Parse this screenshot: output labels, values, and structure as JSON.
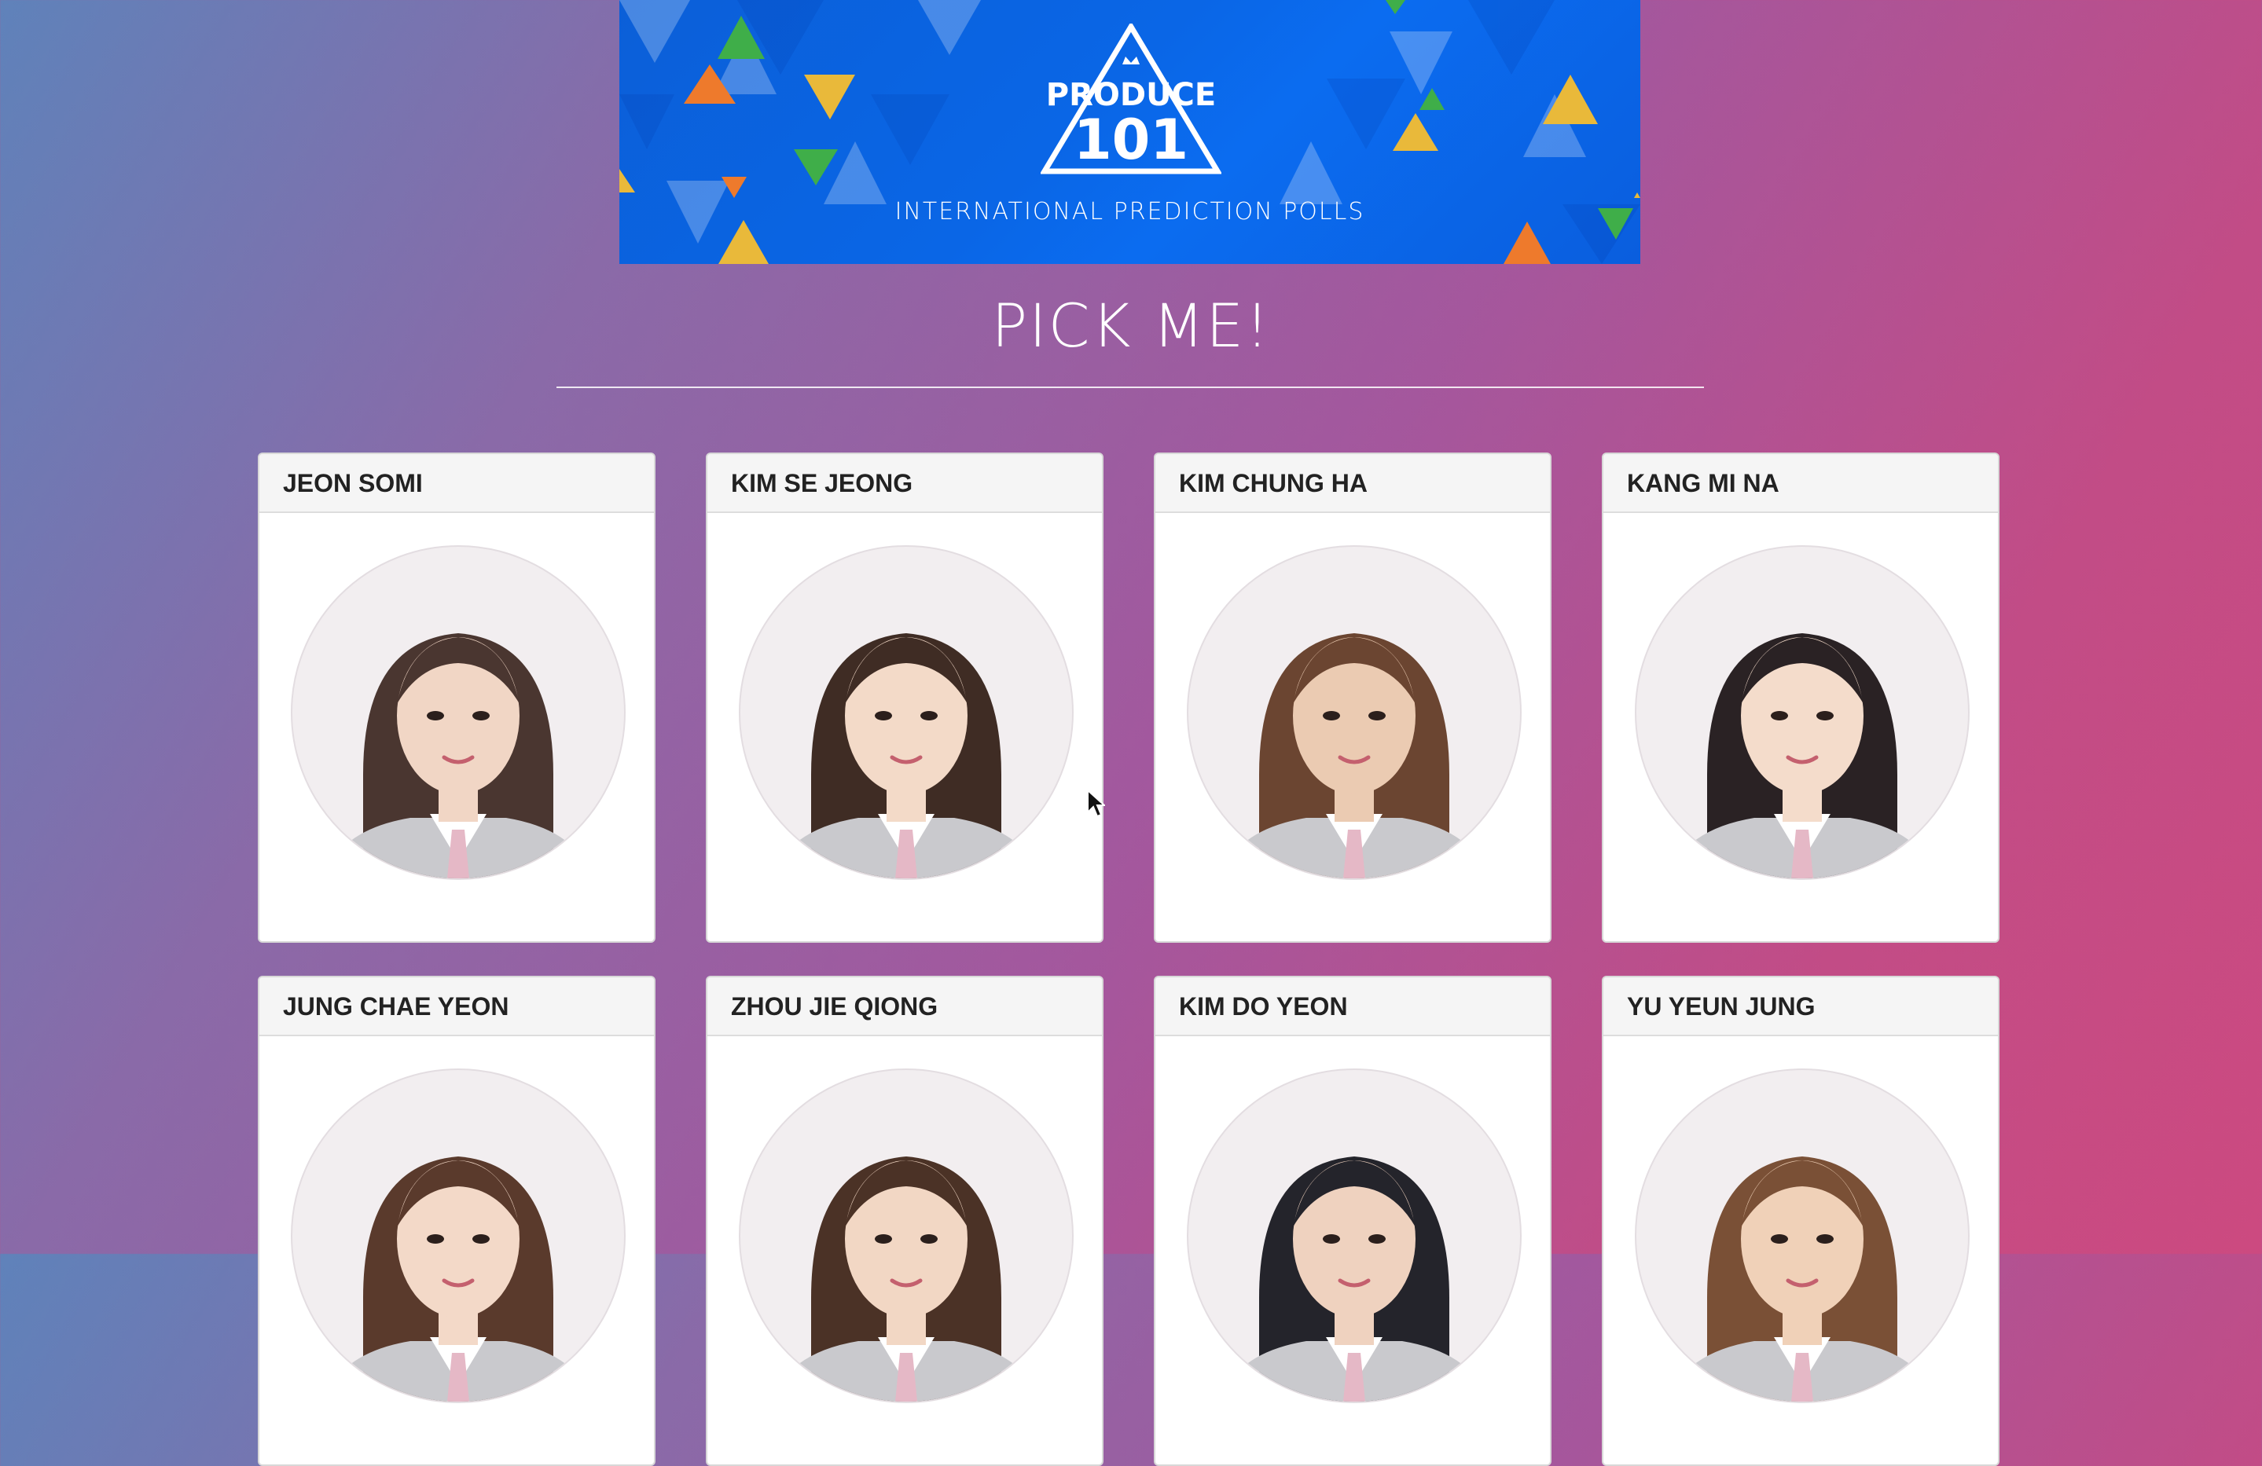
{
  "banner": {
    "logo_top": "PRODUCE",
    "logo_number": "101",
    "subtitle": "INTERNATIONAL PREDICTION POLLS"
  },
  "page_title": "PICK ME!",
  "trainees": [
    {
      "name": "JEON SOMI",
      "hair": "#4a3630",
      "skin": "#f1d6c5"
    },
    {
      "name": "KIM SE JEONG",
      "hair": "#3f2c24",
      "skin": "#f3dac8"
    },
    {
      "name": "KIM CHUNG HA",
      "hair": "#6b4531",
      "skin": "#ebcbb2"
    },
    {
      "name": "KANG MI NA",
      "hair": "#2a2224",
      "skin": "#f4dccb"
    },
    {
      "name": "JUNG CHAE YEON",
      "hair": "#5a3a2c",
      "skin": "#f3d9c8"
    },
    {
      "name": "ZHOU JIE QIONG",
      "hair": "#4b3226",
      "skin": "#f2d7c4"
    },
    {
      "name": "KIM DO YEON",
      "hair": "#24242b",
      "skin": "#efd2bf"
    },
    {
      "name": "YU YEUN JUNG",
      "hair": "#7a5036",
      "skin": "#f0d1b8"
    }
  ]
}
